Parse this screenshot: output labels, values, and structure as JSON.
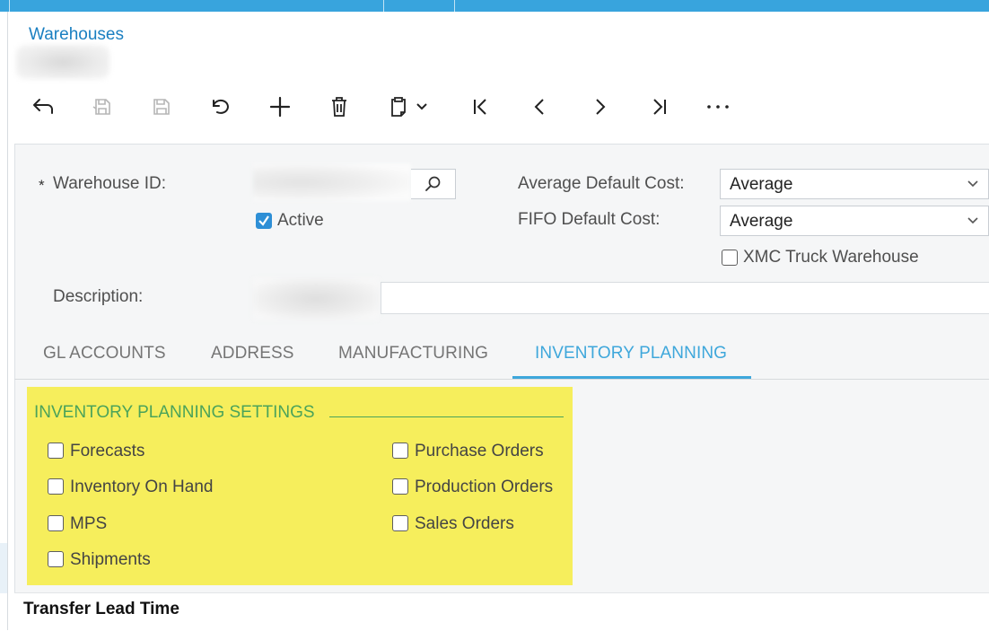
{
  "breadcrumb": "Warehouses",
  "form": {
    "warehouse_id_label": "Warehouse ID:",
    "required_marker": "*",
    "active_label": "Active",
    "active_checked": true,
    "description_label": "Description:",
    "avg_cost_label": "Average Default Cost:",
    "avg_cost_value": "Average",
    "fifo_cost_label": "FIFO Default Cost:",
    "fifo_cost_value": "Average",
    "xmc_label": "XMC Truck Warehouse",
    "xmc_checked": false
  },
  "tabs": [
    {
      "label": "GL ACCOUNTS",
      "active": false
    },
    {
      "label": "ADDRESS",
      "active": false
    },
    {
      "label": "MANUFACTURING",
      "active": false
    },
    {
      "label": "INVENTORY PLANNING",
      "active": true
    }
  ],
  "inventory_planning": {
    "title": "INVENTORY PLANNING SETTINGS",
    "left_options": [
      {
        "label": "Forecasts",
        "checked": false
      },
      {
        "label": "Inventory On Hand",
        "checked": false
      },
      {
        "label": "MPS",
        "checked": false
      },
      {
        "label": "Shipments",
        "checked": false
      }
    ],
    "right_options": [
      {
        "label": "Purchase Orders",
        "checked": false
      },
      {
        "label": "Production Orders",
        "checked": false
      },
      {
        "label": "Sales Orders",
        "checked": false
      }
    ]
  },
  "transfer_lead_time": "Transfer Lead Time",
  "colors": {
    "accent": "#3ea7db",
    "link": "#1a7fc1",
    "highlight": "#f6ee5c",
    "section_green": "#4ba35a",
    "checkbox_checked": "#2e8fd6"
  },
  "toolbar_icons": [
    "back-arrow-icon",
    "save-close-icon",
    "save-icon",
    "undo-icon",
    "plus-icon",
    "trash-icon",
    "clipboard-icon",
    "chevron-down-icon",
    "first-record-icon",
    "previous-icon",
    "next-icon",
    "last-record-icon",
    "more-icon"
  ]
}
